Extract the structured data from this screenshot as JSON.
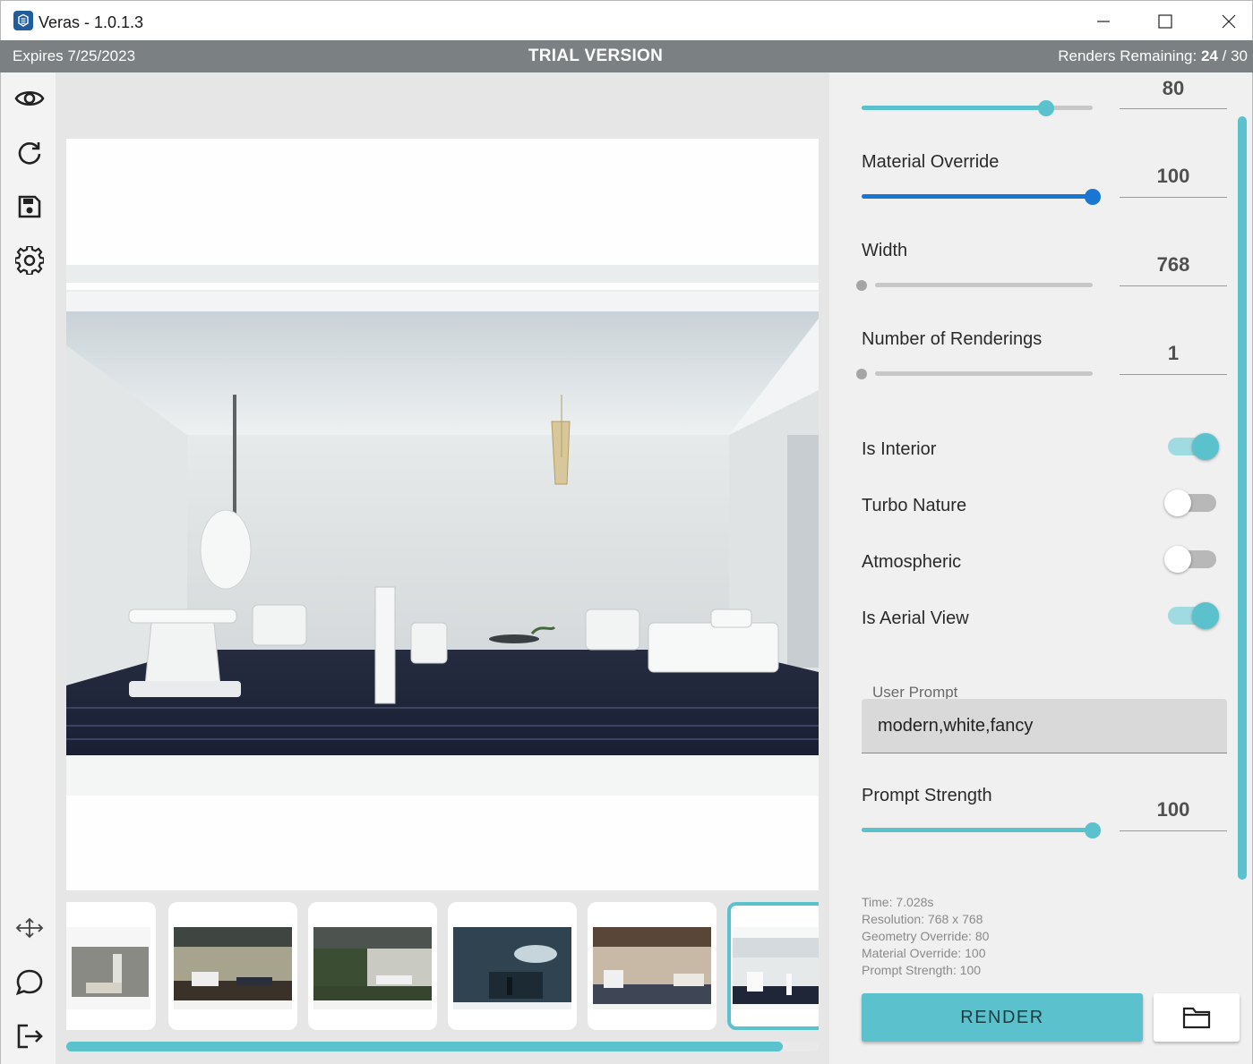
{
  "window": {
    "title": "Veras - 1.0.1.3",
    "controls": [
      "minimize",
      "maximize",
      "close"
    ]
  },
  "trial_bar": {
    "expires": "Expires 7/25/2023",
    "title": "TRIAL VERSION",
    "renders_label": "Renders Remaining:",
    "renders_used": "24",
    "renders_sep": "/",
    "renders_total": "30"
  },
  "sidebar": {
    "top_icons": [
      "eye-icon",
      "refresh-icon",
      "save-icon",
      "gear-icon"
    ],
    "bottom_icons": [
      "move-icon",
      "chat-icon",
      "logout-icon"
    ]
  },
  "controls": {
    "geometry_override": {
      "value": "80",
      "fraction": 0.8
    },
    "material_override": {
      "label": "Material Override",
      "value": "100",
      "fraction": 1.0
    },
    "width": {
      "label": "Width",
      "value": "768",
      "fraction": 0.0
    },
    "num_renderings": {
      "label": "Number of Renderings",
      "value": "1",
      "fraction": 0.0
    },
    "toggles": [
      {
        "label": "Is Interior",
        "on": true
      },
      {
        "label": "Turbo Nature",
        "on": false
      },
      {
        "label": "Atmospheric",
        "on": false
      },
      {
        "label": "Is Aerial View",
        "on": true
      }
    ],
    "prompt": {
      "label": "User Prompt",
      "value": "modern,white,fancy"
    },
    "prompt_strength": {
      "label": "Prompt Strength",
      "value": "100",
      "fraction": 1.0
    }
  },
  "stats": {
    "time": "Time: 7.028s",
    "resolution": "Resolution: 768 x 768",
    "geometry": "Geometry Override: 80",
    "material": "Material Override: 100",
    "prompt_strength": "Prompt Strength: 100"
  },
  "buttons": {
    "render": "RENDER"
  },
  "thumbnails": {
    "count": 6,
    "selected_index": 5
  },
  "colors": {
    "accent": "#5bc2cd",
    "slider_active": "#1976d2",
    "trial_bar": "#7b8082"
  }
}
